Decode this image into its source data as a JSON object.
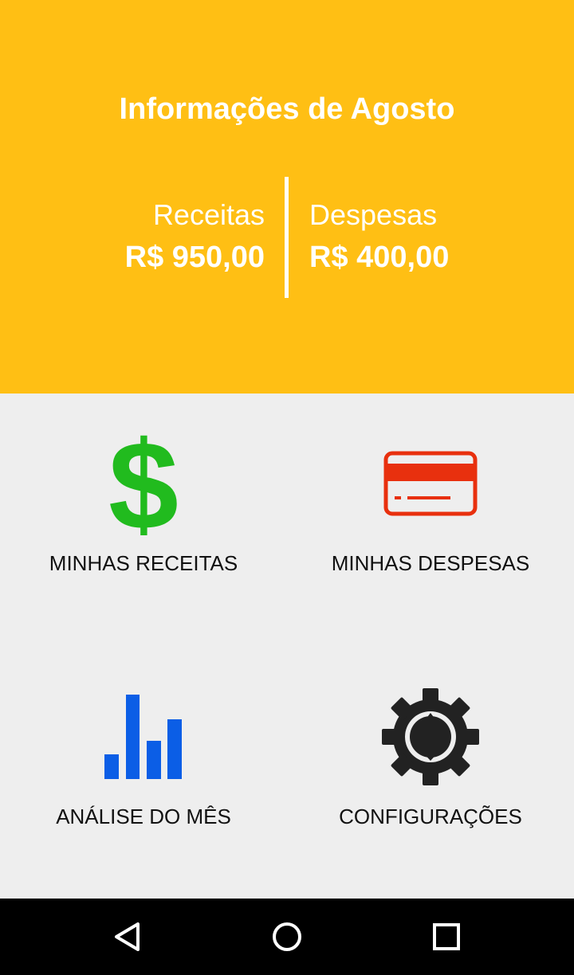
{
  "header": {
    "title": "Informações de Agosto",
    "income_label": "Receitas",
    "income_value": "R$ 950,00",
    "expense_label": "Despesas",
    "expense_value": "R$ 400,00",
    "background_color": "#ffbf14"
  },
  "menu": {
    "items": [
      {
        "label": "MINHAS RECEITAS",
        "icon": "dollar-icon",
        "color": "#21bb1e"
      },
      {
        "label": "MINHAS DESPESAS",
        "icon": "credit-card-icon",
        "color": "#e8300e"
      },
      {
        "label": "ANÁLISE DO MÊS",
        "icon": "bar-chart-icon",
        "color": "#0b5ee6"
      },
      {
        "label": "CONFIGURAÇÕES",
        "icon": "gear-icon",
        "color": "#222222"
      }
    ]
  },
  "navigation": {
    "buttons": [
      "back-icon",
      "home-icon",
      "recents-icon"
    ]
  }
}
